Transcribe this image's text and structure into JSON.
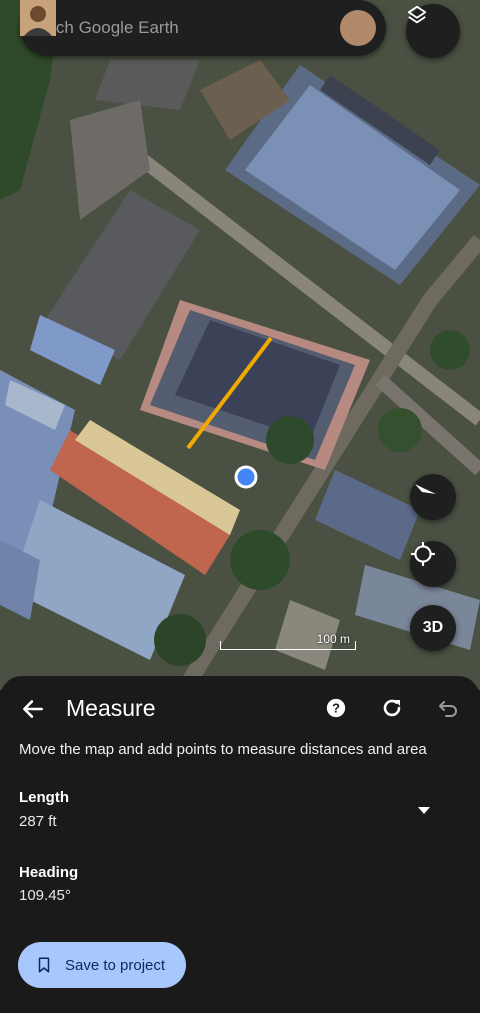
{
  "search": {
    "placeholder": "Search Google Earth"
  },
  "map": {
    "scale_label": "100 m",
    "three_d_label": "3D"
  },
  "measure": {
    "title": "Measure",
    "instructions": "Move the map and add points to measure distances and area",
    "length_label": "Length",
    "length_value": "287 ft",
    "heading_label": "Heading",
    "heading_value": "109.45°",
    "save_label": "Save to project"
  },
  "colors": {
    "measure_line": "#f2a900",
    "save_button": "#a8c7fa",
    "point_marker": "#4285f4"
  }
}
